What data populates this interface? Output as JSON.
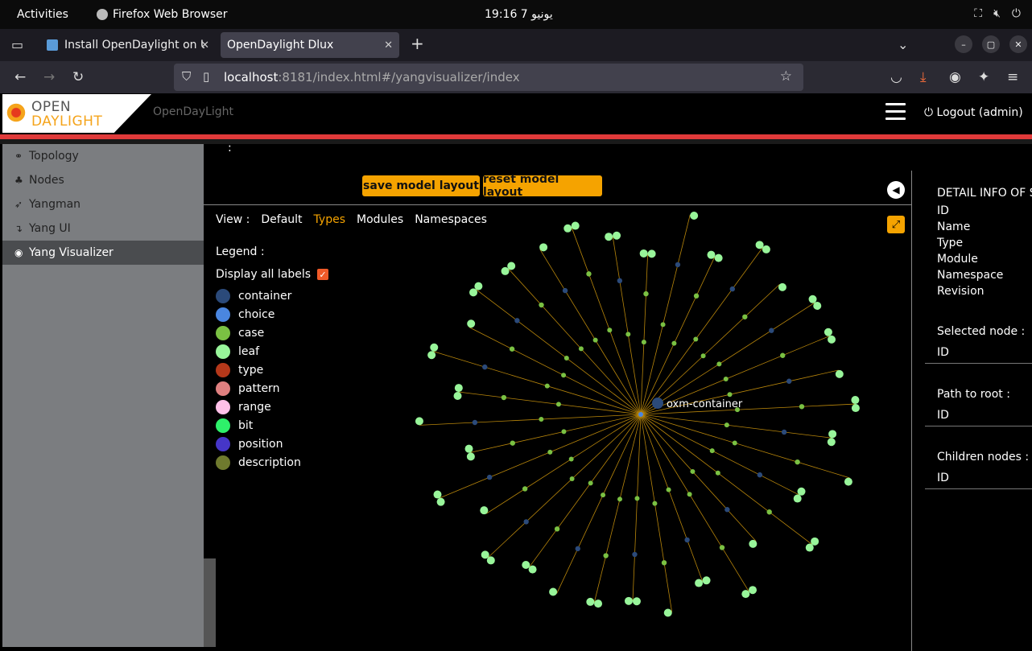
{
  "gnome": {
    "activities": "Activities",
    "app_name": "Firefox Web Browser",
    "clock": "19:16  7 يونيو"
  },
  "tabs": [
    {
      "label": "Install OpenDaylight on U"
    },
    {
      "label": "OpenDaylight Dlux"
    }
  ],
  "nav": {
    "url_host": "localhost",
    "url_path": ":8181/index.html#/yangvisualizer/index"
  },
  "header": {
    "logo_line1": "OPEN",
    "logo_line2": "DAYLIGHT",
    "brand": "OpenDayLight",
    "logout": "Logout (admin)"
  },
  "sidebar": {
    "items": [
      {
        "label": "Topology",
        "icon": "link-icon"
      },
      {
        "label": "Nodes",
        "icon": "sitemap-icon"
      },
      {
        "label": "Yangman",
        "icon": "rocket-icon"
      },
      {
        "label": "Yang UI",
        "icon": "arrow-icon"
      },
      {
        "label": "Yang Visualizer",
        "icon": "eye-icon",
        "active": true
      }
    ]
  },
  "main": {
    "colon": ":",
    "save_label": "save model layout",
    "reset_label": "reset model layout",
    "view_label": "View :",
    "views": [
      "Default",
      "Types",
      "Modules",
      "Namespaces"
    ],
    "selected_view": "Types",
    "legend_label": "Legend :",
    "display_all_labels": "Display all labels",
    "legend": [
      {
        "label": "container",
        "color": "#2b4a7a"
      },
      {
        "label": "choice",
        "color": "#4a86e0"
      },
      {
        "label": "case",
        "color": "#7ac143"
      },
      {
        "label": "leaf",
        "color": "#98f59a"
      },
      {
        "label": "type",
        "color": "#b5381a"
      },
      {
        "label": "pattern",
        "color": "#e08080"
      },
      {
        "label": "range",
        "color": "#ffc0e8"
      },
      {
        "label": "bit",
        "color": "#2ef06a"
      },
      {
        "label": "position",
        "color": "#4636c8"
      },
      {
        "label": "description",
        "color": "#6f7a2e"
      }
    ],
    "root_node_label": "oxm-container"
  },
  "detail": {
    "title": "DETAIL INFO OF S",
    "fields": [
      "ID",
      "Name",
      "Type",
      "Module",
      "Namespace",
      "Revision"
    ],
    "selected_node": "Selected node :",
    "selected_id": "ID",
    "path_to_root": "Path to root :",
    "path_id": "ID",
    "children_nodes": "Children nodes :",
    "children_id": "ID"
  },
  "colors": {
    "accent": "#f5a300",
    "header_red": "#e03a3a",
    "edge": "#b8860b"
  }
}
